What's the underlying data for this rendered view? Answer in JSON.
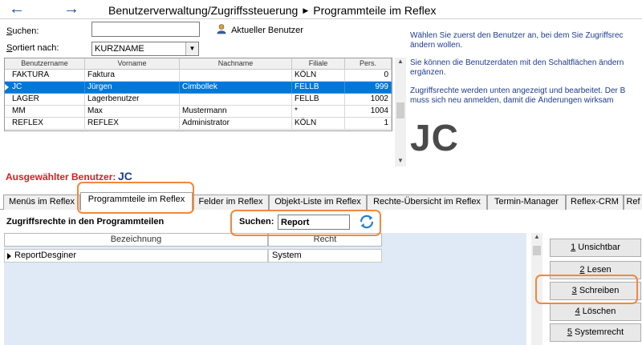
{
  "header": {
    "back_icon": "←",
    "forward_icon": "→",
    "breadcrumb_parent": "Benutzerverwaltung/Zugriffssteuerung",
    "breadcrumb_sep": "▶",
    "breadcrumb_current": "Programmteile im Reflex"
  },
  "search": {
    "label_key": "S",
    "label_rest": "uchen:",
    "value": ""
  },
  "current_user_button": {
    "label": "Aktueller Benutzer"
  },
  "sort": {
    "label_key": "S",
    "label_rest": "ortiert nach:",
    "value": "KURZNAME"
  },
  "user_grid": {
    "columns": [
      "Benutzername",
      "Vorname",
      "Nachname",
      "Filiale",
      "Pers."
    ],
    "rows": [
      {
        "user": "FAKTURA",
        "first": "Faktura",
        "last": "",
        "branch": "KÖLN",
        "pers": "0",
        "selected": false
      },
      {
        "user": "JC",
        "first": "Jürgen",
        "last": "Cimbollek",
        "branch": "FELLB",
        "pers": "999",
        "selected": true
      },
      {
        "user": "LAGER",
        "first": "Lagerbenutzer",
        "last": "",
        "branch": "FELLB",
        "pers": "1002",
        "selected": false
      },
      {
        "user": "MM",
        "first": "Max",
        "last": "Mustermann",
        "branch": "*",
        "pers": "1004",
        "selected": false
      },
      {
        "user": "REFLEX",
        "first": "REFLEX",
        "last": "Administrator",
        "branch": "KÖLN",
        "pers": "1",
        "selected": false
      }
    ]
  },
  "info": {
    "line1": "Wählen Sie zuerst den Benutzer an, bei dem Sie Zugriffsrec",
    "line2": "ändern wollen.",
    "line3": "Sie können die Benutzerdaten mit den Schaltflächen ändern",
    "line4": "ergänzen.",
    "line5": "Zugriffsrechte werden unten angezeigt und bearbeitet. Der B",
    "line6": "muss sich neu  anmelden, damit die Änderungen wirksam"
  },
  "big_initials": "JC",
  "selected_user": {
    "label": "Ausgewählter Benutzer:",
    "value": "JC"
  },
  "tabs": [
    "Menüs im Reflex",
    "Programmteile im Reflex",
    "Felder im Reflex",
    "Objekt-Liste im Reflex",
    "Rechte-Übersicht im Reflex",
    "Termin-Manager",
    "Reflex-CRM",
    "Ref"
  ],
  "rights": {
    "title": "Zugriffsrechte in den Programmteilen",
    "search_label": "Suchen:",
    "search_value": "Report",
    "columns": [
      "Bezeichnung",
      "Recht"
    ],
    "rows": [
      {
        "name": "ReportDesginer",
        "right": "System"
      }
    ]
  },
  "buttons": [
    {
      "key": "1",
      "label": " Unsichtbar"
    },
    {
      "key": "2",
      "label": " Lesen"
    },
    {
      "key": "3",
      "label": " Schreiben"
    },
    {
      "key": "4",
      "label": " Löschen"
    },
    {
      "key": "5",
      "label": " Systemrecht"
    }
  ],
  "colors": {
    "accent": "#0078d7",
    "annotation": "#f0883e",
    "selected_label": "#d61f1f",
    "info_text": "#1f3c8c"
  }
}
